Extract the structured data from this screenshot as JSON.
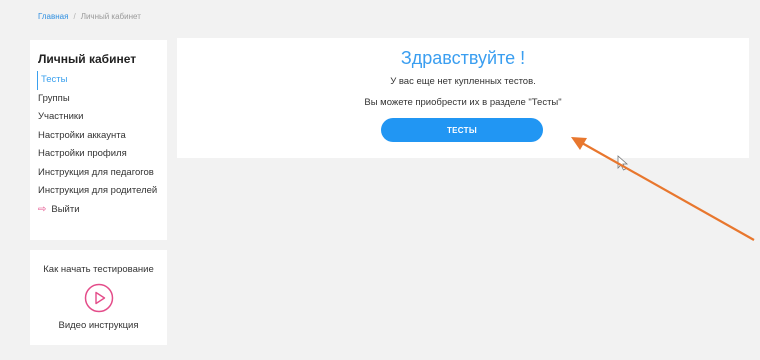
{
  "breadcrumb": {
    "home": "Главная",
    "separator": "/",
    "current": "Личный кабинет"
  },
  "sidebar": {
    "title": "Личный кабинет",
    "items": [
      {
        "label": "Тесты",
        "active": true
      },
      {
        "label": "Группы"
      },
      {
        "label": "Участники"
      },
      {
        "label": "Настройки аккаунта"
      },
      {
        "label": "Настройки профиля"
      },
      {
        "label": "Инструкция для педагогов"
      },
      {
        "label": "Инструкция для родителей"
      },
      {
        "label": "Выйти",
        "icon": "logout-icon"
      }
    ]
  },
  "video": {
    "title": "Как начать тестирование",
    "label": "Видео инструкция",
    "icon": "play-circle-icon"
  },
  "main": {
    "greeting": "Здравствуйте !",
    "message1": "У вас еще нет купленных тестов.",
    "message2": "Вы можете приобрести их в разделе \"Тесты\"",
    "button": "ТЕСТЫ"
  },
  "colors": {
    "accent": "#2196f3",
    "link": "#2f8fe0",
    "logout_icon": "#e44d8a",
    "annotation_arrow": "#e8772e",
    "page_bg": "#f2f2f2"
  }
}
